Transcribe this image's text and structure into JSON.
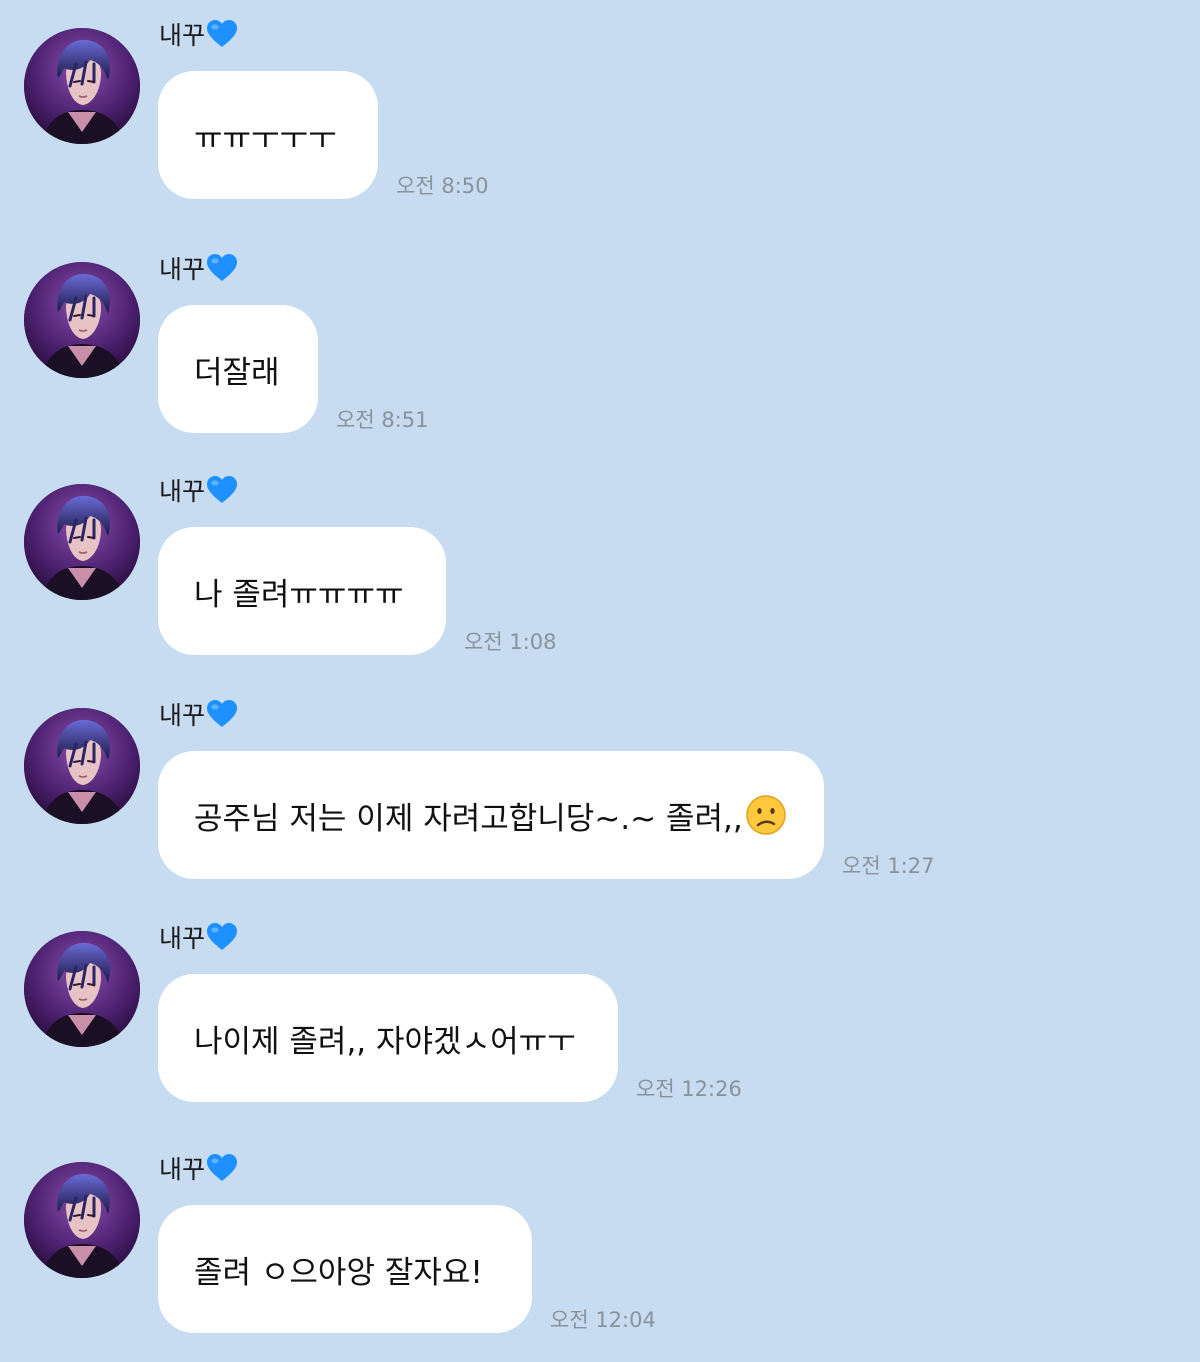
{
  "chat": {
    "messages": [
      {
        "sender": "내꾸",
        "text": "ㅠㅠㅜㅜㅜ",
        "emoji": "",
        "time": "오전 8:50"
      },
      {
        "sender": "내꾸",
        "text": "더잘래",
        "emoji": "",
        "time": "오전 8:51"
      },
      {
        "sender": "내꾸",
        "text": "나 졸려ㅠㅠㅠㅠ",
        "emoji": "",
        "time": "오전 1:08"
      },
      {
        "sender": "내꾸",
        "text": "공주님 저는 이제 자려고합니당~.~ 졸려,,",
        "emoji": "confused-face-icon",
        "time": "오전 1:27"
      },
      {
        "sender": "내꾸",
        "text": "나이제 졸려,, 자야겠ㅅ어ㅠㅜ",
        "emoji": "",
        "time": "오전 12:26"
      },
      {
        "sender": "내꾸",
        "text": "졸려 ㅇ으아앙 잘자요!",
        "emoji": "",
        "time": "오전 12:04"
      }
    ]
  },
  "colors": {
    "background": "#c7dcf0",
    "bubble": "#ffffff",
    "timestamp": "#8a929c",
    "heart": "#1e90ff"
  },
  "icons": {
    "sender_badge": "blue-heart-icon",
    "avatar": "profile-avatar"
  }
}
